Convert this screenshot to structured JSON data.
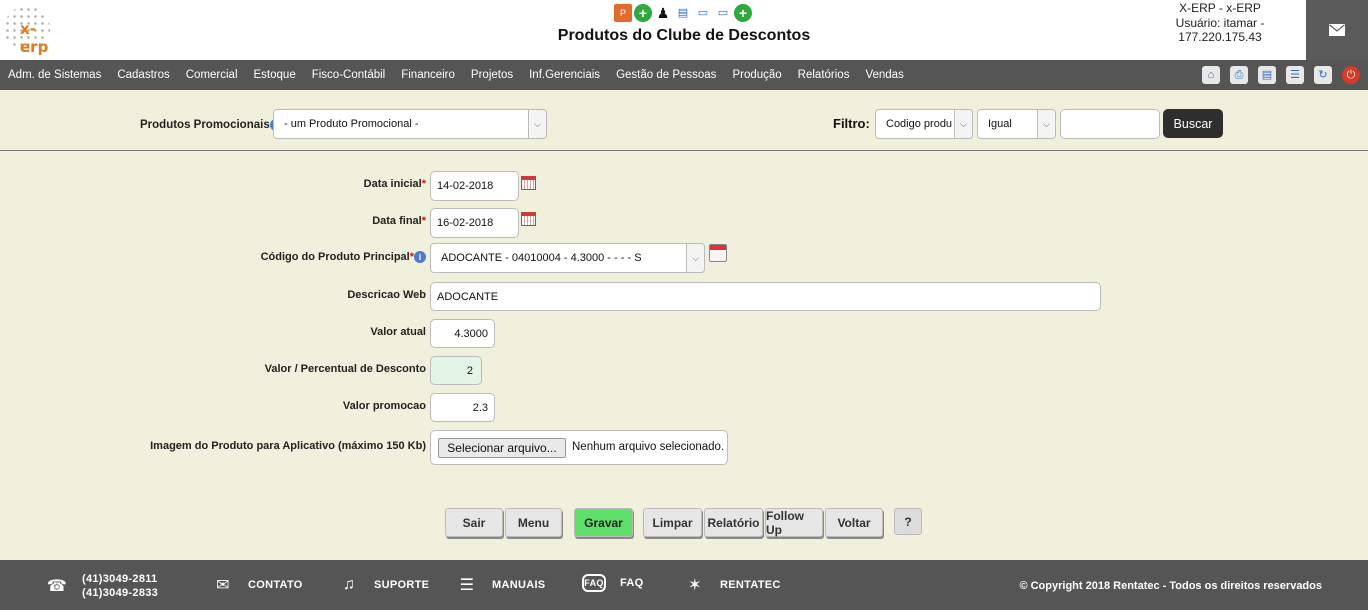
{
  "header": {
    "logo_text": "x-erp",
    "title": "Produtos do Clube de Descontos",
    "system": "X-ERP - x-ERP",
    "user": "Usuário: itamar -",
    "ip": "177.220.175.43"
  },
  "menu": {
    "items": [
      "Adm. de Sistemas",
      "Cadastros",
      "Comercial",
      "Estoque",
      "Fisco-Contábil",
      "Financeiro",
      "Projetos",
      "Inf.Gerenciais",
      "Gestão de Pessoas",
      "Produção",
      "Relatórios",
      "Vendas"
    ]
  },
  "filter": {
    "promo_label": "Produtos Promocionais",
    "promo_value": "- um Produto Promocional -",
    "filtro_label": "Filtro:",
    "field_value": "Codigo produ",
    "operator_value": "Igual",
    "search_value": "",
    "buscar_label": "Buscar"
  },
  "form": {
    "data_inicial_label": "Data inicial",
    "data_inicial_value": "14-02-2018",
    "data_final_label": "Data final",
    "data_final_value": "16-02-2018",
    "codigo_label": "Código do Produto Principal",
    "codigo_value": "ADOCANTE - 04010004 - 4.3000 - - - - S",
    "descricao_label": "Descricao Web",
    "descricao_value": "ADOCANTE",
    "valor_atual_label": "Valor atual",
    "valor_atual_value": "4.3000",
    "desconto_label": "Valor / Percentual de Desconto",
    "desconto_value": "2",
    "promocao_label": "Valor promocao",
    "promocao_value": "2.3",
    "imagem_label": "Imagem do Produto para Aplicativo (máximo 150 Kb)",
    "file_button": "Selecionar arquivo...",
    "file_status": "Nenhum arquivo selecionado.",
    "required_mark": "*"
  },
  "buttons": {
    "sair": "Sair",
    "menu": "Menu",
    "gravar": "Gravar",
    "limpar": "Limpar",
    "relatorio": "Relatório",
    "followup": "Follow Up",
    "voltar": "Voltar",
    "help": "?"
  },
  "footer": {
    "phone1": "(41)3049-2811",
    "phone2": "(41)3049-2833",
    "contato": "CONTATO",
    "suporte": "SUPORTE",
    "manuais": "MANUAIS",
    "faq": "FAQ",
    "rentatec": "RENTATEC",
    "copyright": "© Copyright 2018 Rentatec - Todos os direitos reservados"
  },
  "colors": {
    "bar": "#555555",
    "background": "#f0f0dc",
    "gravar": "#5ee06a",
    "discount_field": "#e2f5e6"
  }
}
